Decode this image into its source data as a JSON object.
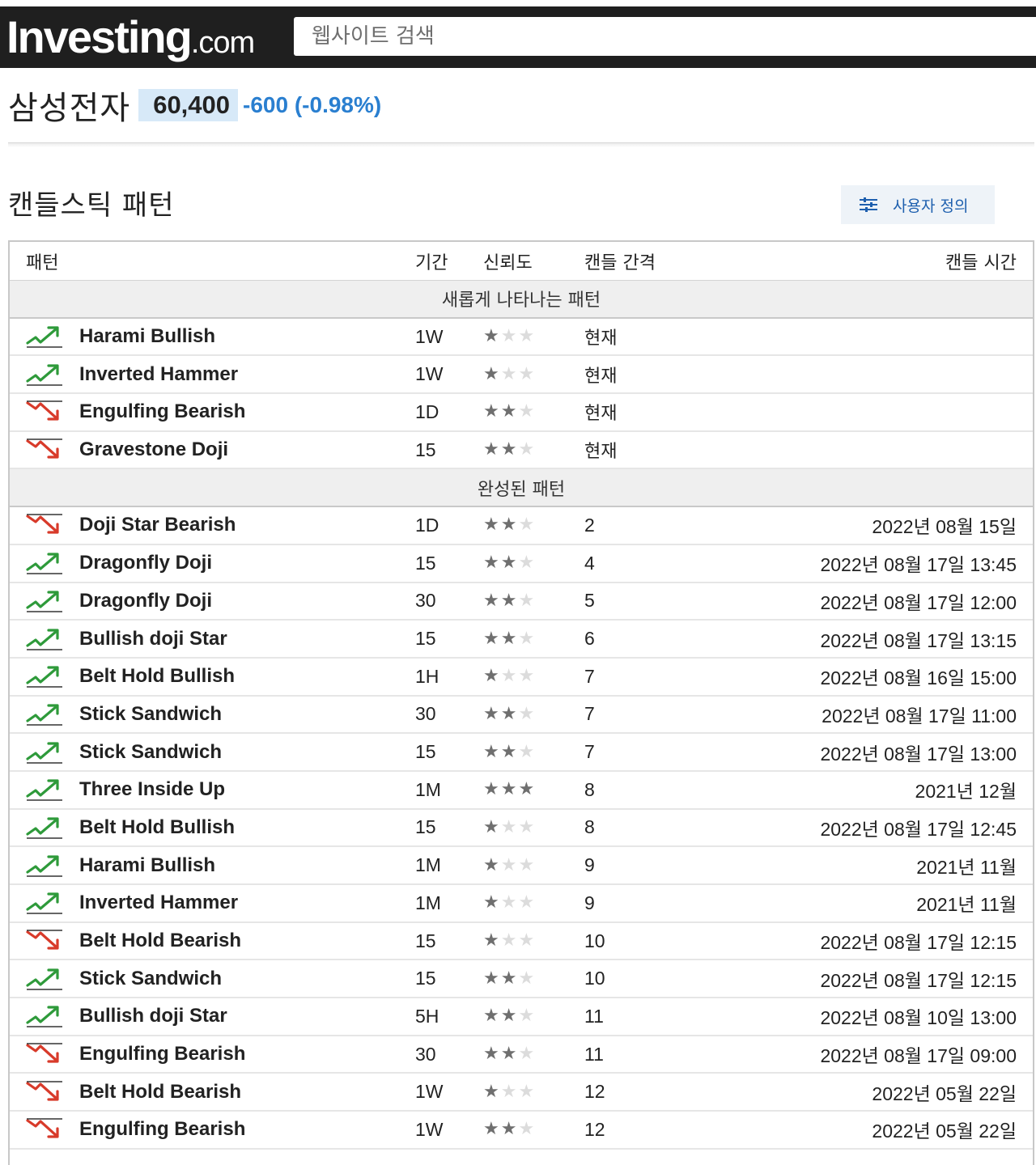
{
  "site": {
    "logo_main": "Investing",
    "logo_domain": ".com"
  },
  "search": {
    "placeholder": "웹사이트 검색"
  },
  "stock": {
    "name": "삼성전자",
    "price": "60,400",
    "change": "-600 (-0.98%)"
  },
  "section": {
    "title": "캔들스틱 패턴",
    "custom_label": "사용자 정의"
  },
  "colors": {
    "bullish": "#2e9a3a",
    "bearish": "#d83a2a",
    "change_blue": "#2a7fd0"
  },
  "table": {
    "headers": {
      "pattern": "패턴",
      "period": "기간",
      "reliability": "신뢰도",
      "gap": "캔들 간격",
      "time": "캔들 시간"
    },
    "groups": [
      {
        "title": "새롭게 나타나는 패턴",
        "rows": [
          {
            "dir": "up",
            "name": "Harami Bullish",
            "period": "1W",
            "stars": 1,
            "gap": "현재",
            "time": ""
          },
          {
            "dir": "up",
            "name": "Inverted Hammer",
            "period": "1W",
            "stars": 1,
            "gap": "현재",
            "time": ""
          },
          {
            "dir": "down",
            "name": "Engulfing Bearish",
            "period": "1D",
            "stars": 2,
            "gap": "현재",
            "time": ""
          },
          {
            "dir": "down",
            "name": "Gravestone Doji",
            "period": "15",
            "stars": 2,
            "gap": "현재",
            "time": ""
          }
        ]
      },
      {
        "title": "완성된 패턴",
        "rows": [
          {
            "dir": "down",
            "name": "Doji Star Bearish",
            "period": "1D",
            "stars": 2,
            "gap": "2",
            "time": "2022년 08월 15일"
          },
          {
            "dir": "up",
            "name": "Dragonfly Doji",
            "period": "15",
            "stars": 2,
            "gap": "4",
            "time": "2022년 08월 17일 13:45"
          },
          {
            "dir": "up",
            "name": "Dragonfly Doji",
            "period": "30",
            "stars": 2,
            "gap": "5",
            "time": "2022년 08월 17일 12:00"
          },
          {
            "dir": "up",
            "name": "Bullish doji Star",
            "period": "15",
            "stars": 2,
            "gap": "6",
            "time": "2022년 08월 17일 13:15"
          },
          {
            "dir": "up",
            "name": "Belt Hold Bullish",
            "period": "1H",
            "stars": 1,
            "gap": "7",
            "time": "2022년 08월 16일 15:00"
          },
          {
            "dir": "up",
            "name": "Stick Sandwich",
            "period": "30",
            "stars": 2,
            "gap": "7",
            "time": "2022년 08월 17일 11:00"
          },
          {
            "dir": "up",
            "name": "Stick Sandwich",
            "period": "15",
            "stars": 2,
            "gap": "7",
            "time": "2022년 08월 17일 13:00"
          },
          {
            "dir": "up",
            "name": "Three Inside Up",
            "period": "1M",
            "stars": 3,
            "gap": "8",
            "time": "2021년 12월"
          },
          {
            "dir": "up",
            "name": "Belt Hold Bullish",
            "period": "15",
            "stars": 1,
            "gap": "8",
            "time": "2022년 08월 17일 12:45"
          },
          {
            "dir": "up",
            "name": "Harami Bullish",
            "period": "1M",
            "stars": 1,
            "gap": "9",
            "time": "2021년 11월"
          },
          {
            "dir": "up",
            "name": "Inverted Hammer",
            "period": "1M",
            "stars": 1,
            "gap": "9",
            "time": "2021년 11월"
          },
          {
            "dir": "down",
            "name": "Belt Hold Bearish",
            "period": "15",
            "stars": 1,
            "gap": "10",
            "time": "2022년 08월 17일 12:15"
          },
          {
            "dir": "up",
            "name": "Stick Sandwich",
            "period": "15",
            "stars": 2,
            "gap": "10",
            "time": "2022년 08월 17일 12:15"
          },
          {
            "dir": "up",
            "name": "Bullish doji Star",
            "period": "5H",
            "stars": 2,
            "gap": "11",
            "time": "2022년 08월 10일 13:00"
          },
          {
            "dir": "down",
            "name": "Engulfing Bearish",
            "period": "30",
            "stars": 2,
            "gap": "11",
            "time": "2022년 08월 17일 09:00"
          },
          {
            "dir": "down",
            "name": "Belt Hold Bearish",
            "period": "1W",
            "stars": 1,
            "gap": "12",
            "time": "2022년 05월 22일"
          },
          {
            "dir": "down",
            "name": "Engulfing Bearish",
            "period": "1W",
            "stars": 2,
            "gap": "12",
            "time": "2022년 05월 22일"
          }
        ]
      }
    ]
  }
}
